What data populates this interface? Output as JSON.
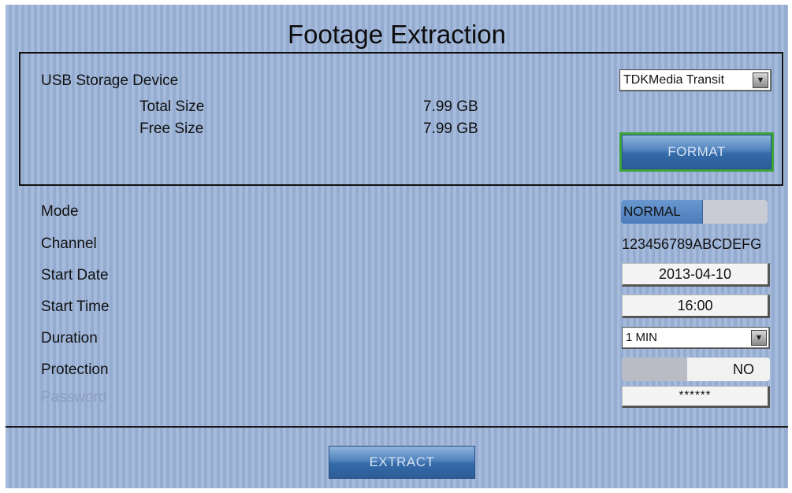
{
  "title": "Footage Extraction",
  "usb": {
    "label": "USB Storage Device",
    "device_selected": "TDKMedia Transit",
    "total_size_label": "Total Size",
    "total_size_value": "7.99 GB",
    "free_size_label": "Free Size",
    "free_size_value": "7.99 GB",
    "format_label": "FORMAT"
  },
  "settings": {
    "mode_label": "Mode",
    "mode_value": "NORMAL",
    "channel_label": "Channel",
    "channel_value": "123456789ABCDEFG",
    "start_date_label": "Start Date",
    "start_date_value": "2013-04-10",
    "start_time_label": "Start Time",
    "start_time_value": "16:00",
    "duration_label": "Duration",
    "duration_value": "1 MIN",
    "protection_label": "Protection",
    "protection_value": "NO",
    "password_label": "Password",
    "password_value": "******"
  },
  "footer": {
    "extract_label": "EXTRACT"
  },
  "colors": {
    "background": "#9cb3d8",
    "button": "#4f82bd",
    "focus_outline": "#3ca53c",
    "toggle_on": "#5283c1",
    "disabled_text": "#8c9ec0"
  }
}
